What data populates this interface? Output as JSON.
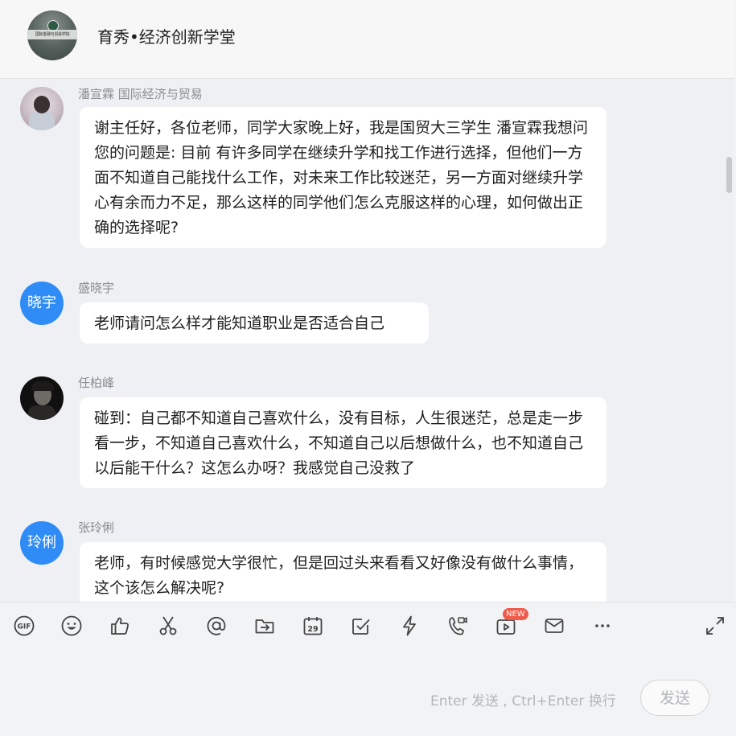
{
  "header": {
    "title": "育秀•经济创新学堂",
    "avatar_text": "国际金融与贸易学院"
  },
  "messages": [
    {
      "sender": "潘宣霖 国际经济与贸易",
      "text": "谢主任好，各位老师，同学大家晚上好，我是国贸大三学生 潘宣霖我想问您的问题是: 目前 有许多同学在继续升学和找工作进行选择，但他们一方面不知道自己能找什么工作，对未来工作比较迷茫，另一方面对继续升学心有余而力不足，那么这样的同学他们怎么克服这样的心理，如何做出正确的选择呢?"
    },
    {
      "sender": "盛晓宇",
      "avatar_text": "晓宇",
      "text": "老师请问怎么样才能知道职业是否适合自己"
    },
    {
      "sender": "任柏峰",
      "text": "碰到：自己都不知道自己喜欢什么，没有目标，人生很迷茫，总是走一步看一步，不知道自己喜欢什么，不知道自己以后想做什么，也不知道自己以后能干什么？这怎么办呀？我感觉自己没救了"
    },
    {
      "sender": "张玲俐",
      "avatar_text": "玲俐",
      "text": "老师，有时候感觉大学很忙，但是回过头来看看又好像没有做什么事情，这个该怎么解决呢?"
    }
  ],
  "toolbar": {
    "new_badge": "NEW",
    "gif_label": "GIF",
    "calendar_day": "29",
    "icons": [
      "gif-icon",
      "emoji-icon",
      "thumbs-up-icon",
      "scissors-icon",
      "at-icon",
      "forward-icon",
      "calendar-icon",
      "checkin-icon",
      "lightning-icon",
      "video-call-icon",
      "live-icon",
      "mail-icon",
      "more-icon",
      "expand-icon"
    ]
  },
  "composer": {
    "hint": "Enter 发送 , Ctrl+Enter 换行",
    "send_label": "发送"
  },
  "colors": {
    "accent": "#2f8cf6",
    "badge": "#f05a4a"
  }
}
